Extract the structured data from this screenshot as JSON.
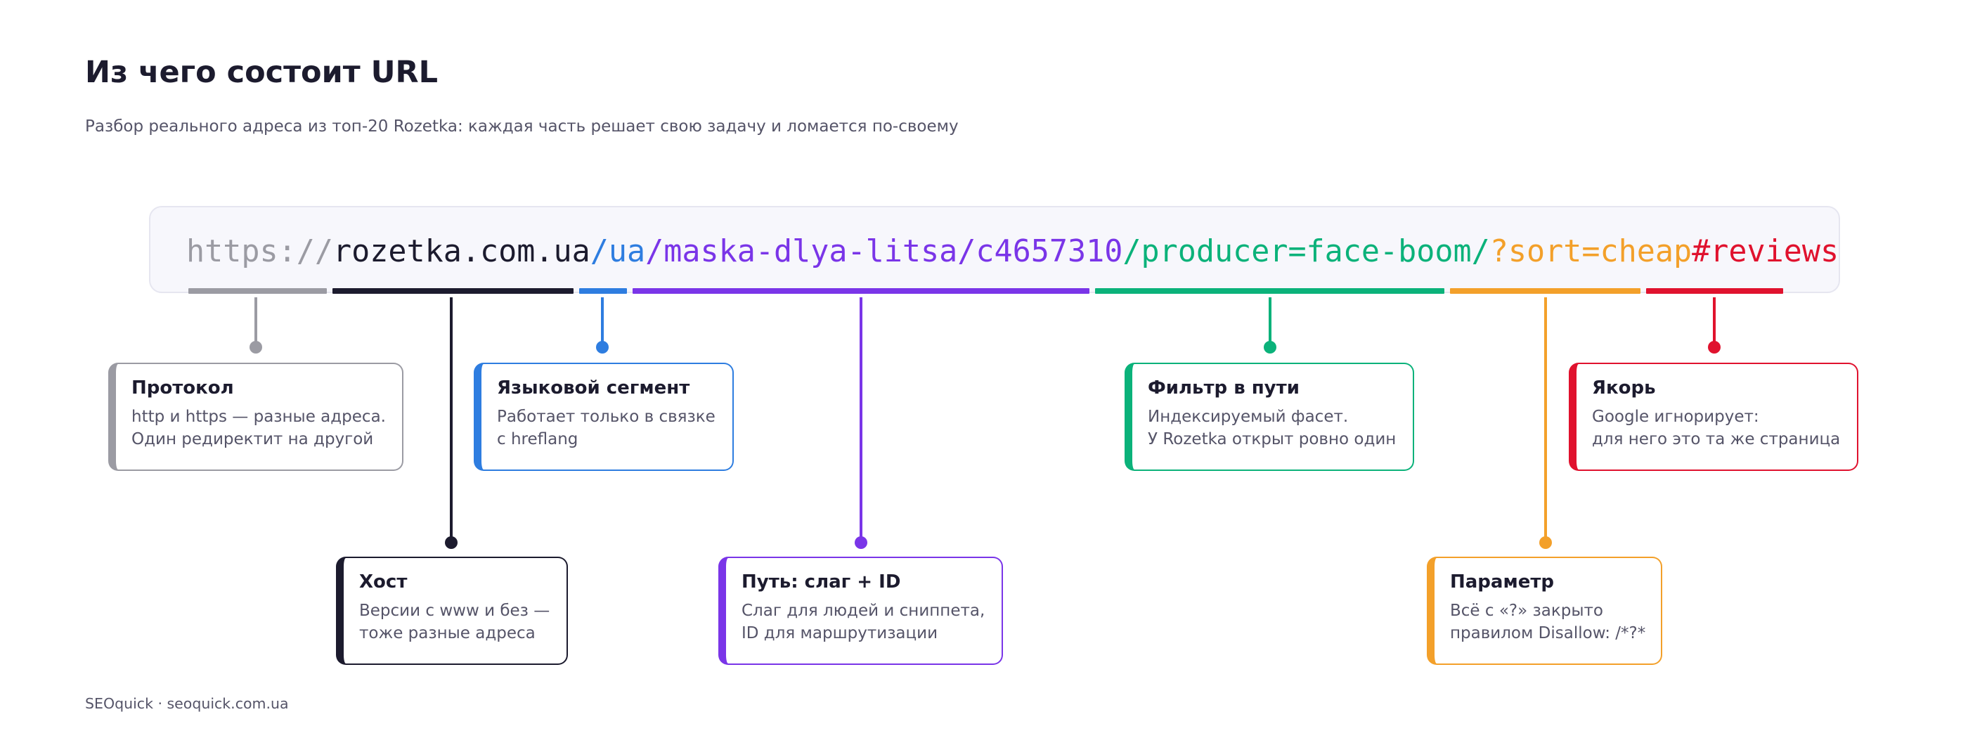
{
  "title": "Из чего состоит URL",
  "subtitle": "Разбор реального адреса из топ-20 Rozetka: каждая часть решает свою задачу и ломается по-своему",
  "footer": "SEOquick · seoquick.com.ua",
  "url_segments": [
    {
      "id": "protocol",
      "text": "https://",
      "color": "#9b9ba3"
    },
    {
      "id": "host",
      "text": "rozetka.com.ua",
      "color": "#1c1b2e"
    },
    {
      "id": "lang",
      "text": "/ua",
      "color": "#2e7de0"
    },
    {
      "id": "path",
      "text": "/maska-dlya-litsa/c4657310",
      "color": "#7a35e8"
    },
    {
      "id": "filter",
      "text": "/producer=face-boom/",
      "color": "#0bb27a"
    },
    {
      "id": "param",
      "text": "?sort=cheap",
      "color": "#f3a02a"
    },
    {
      "id": "anchor",
      "text": "#reviews",
      "color": "#e0122e"
    }
  ],
  "cards": {
    "protocol": {
      "title": "Протокол",
      "lines": [
        "http и https — разные адреса.",
        "Один редиректит на другой"
      ]
    },
    "host": {
      "title": "Хост",
      "lines": [
        "Версии с www и без —",
        "тоже разные адреса"
      ]
    },
    "lang": {
      "title": "Языковой сегмент",
      "lines": [
        "Работает только в связке",
        "с hreflang"
      ]
    },
    "path": {
      "title": "Путь: слаг + ID",
      "lines": [
        "Слаг для людей и сниппета,",
        "ID для маршрутизации"
      ]
    },
    "filter": {
      "title": "Фильтр в пути",
      "lines": [
        "Индексируемый фасет.",
        "У Rozetka открыт ровно один"
      ]
    },
    "param": {
      "title": "Параметр",
      "lines": [
        "Всё с «?» закрыто",
        "правилом Disallow: /*?*"
      ]
    },
    "anchor": {
      "title": "Якорь",
      "lines": [
        "Google игнорирует:",
        "для него это та же страница"
      ]
    }
  }
}
